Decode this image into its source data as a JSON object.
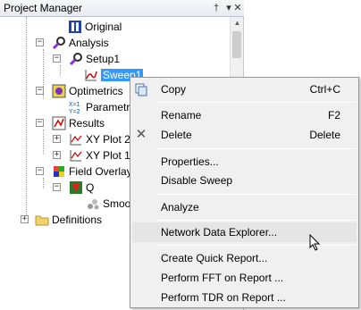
{
  "panel": {
    "title": "Project Manager",
    "pin_glyph": "†",
    "chevron_glyph": "▾",
    "close_glyph": "✕"
  },
  "tree": {
    "original": "Original",
    "analysis": "Analysis",
    "setup1": "Setup1",
    "sweep1": "Sweep1",
    "optimetrics": "Optimetrics",
    "parametric": "Parametric",
    "results": "Results",
    "xyplot2": "XY Plot 2",
    "xyplot1": "XY Plot 1",
    "field_overlays": "Field Overlays",
    "q": "Q",
    "smooth": "Smoot",
    "definitions": "Definitions"
  },
  "menu": {
    "copy": "Copy",
    "copy_shortcut": "Ctrl+C",
    "rename": "Rename",
    "rename_shortcut": "F2",
    "delete": "Delete",
    "delete_shortcut": "Delete",
    "delete_glyph": "✕",
    "properties": "Properties...",
    "disable_sweep": "Disable Sweep",
    "analyze": "Analyze",
    "network_data_explorer": "Network Data Explorer...",
    "create_quick_report": "Create Quick Report...",
    "perform_fft": "Perform FFT on Report ...",
    "perform_tdr": "Perform TDR on Report ..."
  },
  "colors": {
    "selection": "#3399ff",
    "menu_bg": "#f0f0f0",
    "hover": "#e5e5e5"
  }
}
